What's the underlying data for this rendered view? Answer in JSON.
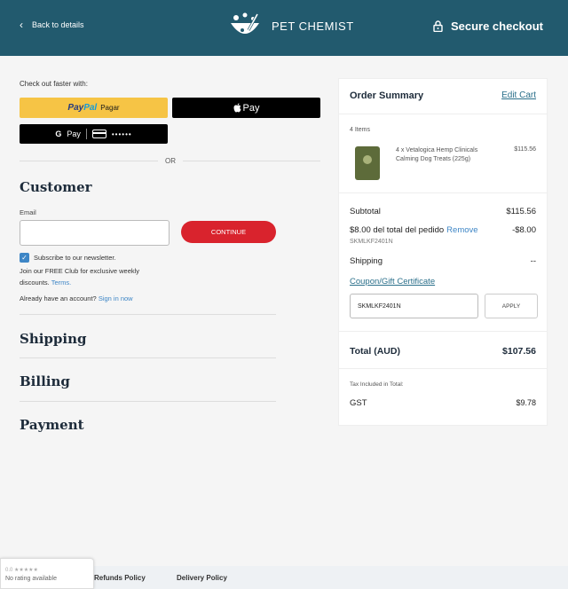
{
  "header": {
    "back_label": "Back to details",
    "brand": "PET CHEMIST",
    "secure_label": "Secure checkout"
  },
  "express": {
    "intro": "Check out faster with:",
    "paypal_word1": "Pay",
    "paypal_word2": "Pal",
    "paypal_action": "Pagar",
    "applepay_label": "Pay",
    "gpay_label": "Pay",
    "gpay_card_masked": "••••••",
    "or_label": "OR"
  },
  "customer": {
    "title": "Customer",
    "email_label": "Email",
    "email_value": "",
    "continue_label": "CONTINUE",
    "newsletter_label": "Subscribe to our newsletter.",
    "club_text": "Join our FREE Club for exclusive weekly discounts.",
    "terms_label": "Terms.",
    "account_text": "Already have an account?",
    "signin_label": "Sign in now"
  },
  "steps": {
    "shipping": "Shipping",
    "billing": "Billing",
    "payment": "Payment"
  },
  "summary": {
    "title": "Order Summary",
    "edit_label": "Edit Cart",
    "items_count": "4 Items",
    "product": {
      "name": "4 x Vetalogica Hemp Clinicals Calming Dog Treats (225g)",
      "price": "$115.56"
    },
    "subtotal_label": "Subtotal",
    "subtotal_value": "$115.56",
    "discount_label": "$8.00 del total del pedido",
    "remove_label": "Remove",
    "discount_value": "-$8.00",
    "discount_code": "SKMLKF2401N",
    "shipping_label": "Shipping",
    "shipping_value": "--",
    "coupon_label": "Coupon/Gift Certificate",
    "coupon_value": "SKMLKF2401N",
    "apply_label": "APPLY",
    "total_label": "Total (AUD)",
    "total_value": "$107.56",
    "tax_label": "Tax Included in Total:",
    "gst_label": "GST",
    "gst_value": "$9.78"
  },
  "footer": {
    "refunds": "Refunds Policy",
    "delivery": "Delivery Policy",
    "rating_score": "0.0 ★★★★★",
    "rating_text": "No rating available"
  },
  "colors": {
    "header_bg": "#225a6e",
    "continue_bg": "#d9232d",
    "paypal_bg": "#f6c445",
    "link": "#3e86c6"
  }
}
